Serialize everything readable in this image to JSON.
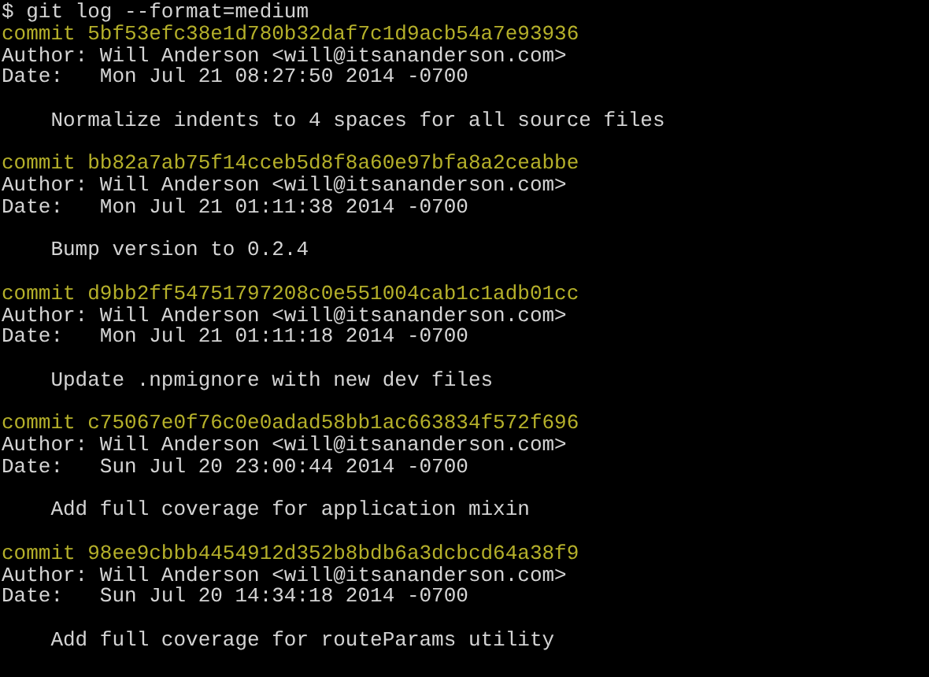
{
  "terminal": {
    "command_line": "$ git log --format=medium",
    "commits": [
      {
        "commit_line": "commit 5bf53efc38e1d780b32daf7c1d9acb54a7e93936",
        "author_line": "Author: Will Anderson <will@itsananderson.com>",
        "date_line": "Date:   Mon Jul 21 08:27:50 2014 -0700",
        "message": "    Normalize indents to 4 spaces for all source files"
      },
      {
        "commit_line": "commit bb82a7ab75f14cceb5d8f8a60e97bfa8a2ceabbe",
        "author_line": "Author: Will Anderson <will@itsananderson.com>",
        "date_line": "Date:   Mon Jul 21 01:11:38 2014 -0700",
        "message": "    Bump version to 0.2.4"
      },
      {
        "commit_line": "commit d9bb2ff54751797208c0e551004cab1c1adb01cc",
        "author_line": "Author: Will Anderson <will@itsananderson.com>",
        "date_line": "Date:   Mon Jul 21 01:11:18 2014 -0700",
        "message": "    Update .npmignore with new dev files"
      },
      {
        "commit_line": "commit c75067e0f76c0e0adad58bb1ac663834f572f696",
        "author_line": "Author: Will Anderson <will@itsananderson.com>",
        "date_line": "Date:   Sun Jul 20 23:00:44 2014 -0700",
        "message": "    Add full coverage for application mixin"
      },
      {
        "commit_line": "commit 98ee9cbbb4454912d352b8bdb6a3dcbcd64a38f9",
        "author_line": "Author: Will Anderson <will@itsananderson.com>",
        "date_line": "Date:   Sun Jul 20 14:34:18 2014 -0700",
        "message": "    Add full coverage for routeParams utility"
      }
    ]
  }
}
